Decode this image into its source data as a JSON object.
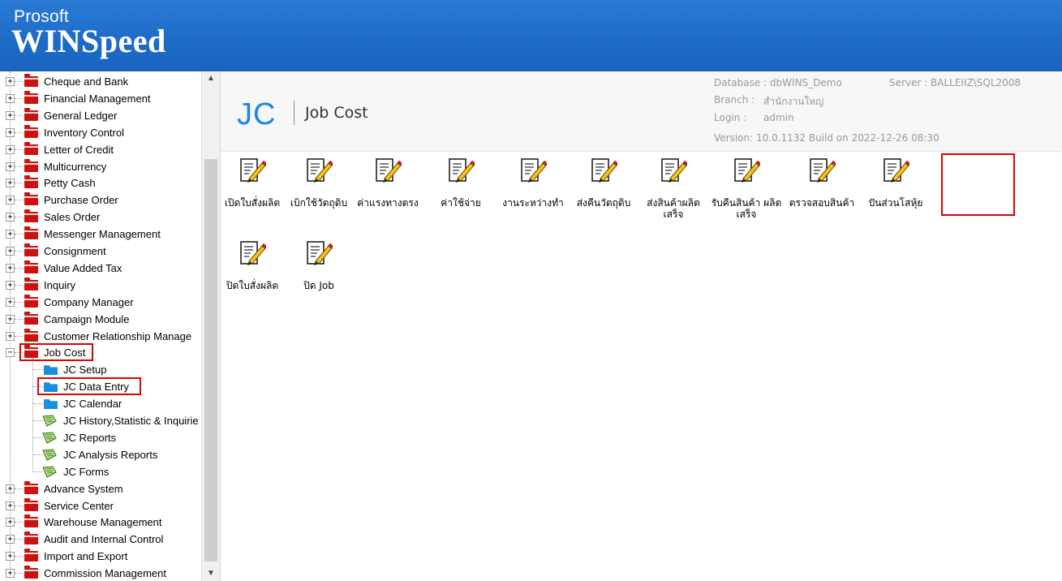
{
  "banner": {
    "brand_small": "Prosoft",
    "brand_big": "WINSpeed"
  },
  "tree": {
    "items": [
      {
        "label": "Cheque and Bank"
      },
      {
        "label": "Financial Management"
      },
      {
        "label": "General Ledger"
      },
      {
        "label": "Inventory Control"
      },
      {
        "label": "Letter of Credit"
      },
      {
        "label": "Multicurrency"
      },
      {
        "label": "Petty Cash"
      },
      {
        "label": "Purchase Order"
      },
      {
        "label": "Sales Order"
      },
      {
        "label": "Messenger Management"
      },
      {
        "label": "Consignment"
      },
      {
        "label": "Value Added Tax"
      },
      {
        "label": "Inquiry"
      },
      {
        "label": "Company Manager"
      },
      {
        "label": "Campaign Module"
      },
      {
        "label": "Customer Relationship Manage"
      },
      {
        "label": "Job Cost"
      }
    ],
    "jobcost_children": [
      {
        "label": "JC Setup"
      },
      {
        "label": "JC Data Entry"
      },
      {
        "label": "JC Calendar"
      },
      {
        "label": "JC History,Statistic & Inquirie"
      },
      {
        "label": "JC Reports"
      },
      {
        "label": "JC Analysis Reports"
      },
      {
        "label": "JC Forms"
      }
    ],
    "items_after": [
      {
        "label": "Advance System"
      },
      {
        "label": "Service Center"
      },
      {
        "label": "Warehouse Management"
      },
      {
        "label": "Audit and Internal Control"
      },
      {
        "label": "Import and Export"
      },
      {
        "label": "Commission Management"
      }
    ],
    "expand_plus": "+",
    "expand_minus": "−"
  },
  "module": {
    "code": "JC",
    "name": "Job Cost"
  },
  "info": {
    "database": "Database : dbWINS_Demo",
    "server": "Server : BALLEIIZ\\SQL2008",
    "branch_label": "Branch :",
    "branch_value": "สำนักงานใหญ่",
    "login_label": "Login :",
    "login_value": "admin",
    "version": "Version: 10.0.1132  Build on 2022-12-26 08:30"
  },
  "apps": [
    {
      "label": "เปิดใบสั่งผลิต"
    },
    {
      "label": "เบิกใช้วัตถุดิบ"
    },
    {
      "label": "ค่าแรงทางตรง"
    },
    {
      "label": "ค่าใช้จ่าย"
    },
    {
      "label": "งานระหว่างทำ"
    },
    {
      "label": "ส่งคืนวัตถุดิบ"
    },
    {
      "label": "ส่งสินค้าผลิต เสร็จ"
    },
    {
      "label": "รับคืนสินค้า ผลิตเสร็จ"
    },
    {
      "label": "ตรวจสอบสินค้า"
    },
    {
      "label": "ปันส่วนโสหุ้ย"
    },
    {
      "label": "ปิดใบสั่งผลิต"
    },
    {
      "label": "ปิด Job"
    }
  ],
  "colors": {
    "banner": "#1e6cc8",
    "accent": "#1e86e8",
    "highlight": "#e00000",
    "folder": "#cc1111"
  }
}
